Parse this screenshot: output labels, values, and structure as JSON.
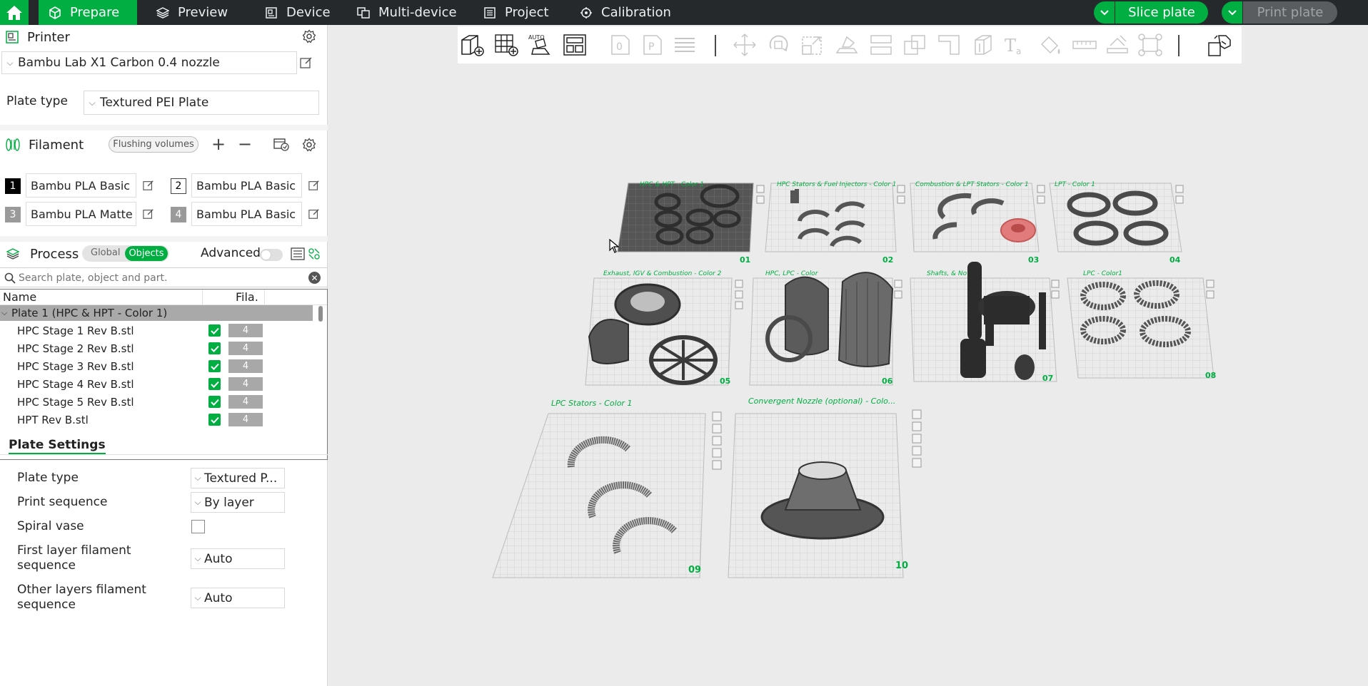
{
  "nav": {
    "tabs": [
      {
        "label": "Prepare",
        "icon": "cube-icon"
      },
      {
        "label": "Preview",
        "icon": "layers-icon"
      },
      {
        "label": "Device",
        "icon": "device-icon"
      },
      {
        "label": "Multi-device",
        "icon": "multi-device-icon"
      },
      {
        "label": "Project",
        "icon": "project-icon"
      },
      {
        "label": "Calibration",
        "icon": "calibration-icon"
      }
    ],
    "active_tab": "Prepare",
    "slice_label": "Slice plate",
    "print_label": "Print plate"
  },
  "printer": {
    "section_title": "Printer",
    "selected": "Bambu Lab X1 Carbon 0.4 nozzle",
    "plate_type_label": "Plate type",
    "plate_type_value": "Textured PEI Plate"
  },
  "filament": {
    "section_title": "Filament",
    "flushing_label": "Flushing volumes",
    "items": [
      {
        "num": "1",
        "name": "Bambu PLA Basic",
        "color": "#000000"
      },
      {
        "num": "2",
        "name": "Bambu PLA Basic",
        "color": "#ffffff"
      },
      {
        "num": "3",
        "name": "Bambu PLA Matte",
        "color": "#9a9a9a"
      },
      {
        "num": "4",
        "name": "Bambu PLA Basic",
        "color": "#9a9a9a"
      }
    ]
  },
  "process": {
    "section_title": "Process",
    "global_label": "Global",
    "objects_label": "Objects",
    "advanced_label": "Advanced",
    "search_placeholder": "Search plate, object and part."
  },
  "tree": {
    "col_name": "Name",
    "col_fila": "Fila.",
    "plate_row": "Plate 1 (HPC & HPT - Color 1)",
    "rows": [
      {
        "name": "HPC Stage 1 Rev B.stl",
        "fila": "4"
      },
      {
        "name": "HPC Stage 2 Rev B.stl",
        "fila": "4"
      },
      {
        "name": "HPC Stage 3 Rev B.stl",
        "fila": "4"
      },
      {
        "name": "HPC Stage 4 Rev B.stl",
        "fila": "4"
      },
      {
        "name": "HPC Stage 5 Rev B.stl",
        "fila": "4"
      },
      {
        "name": "HPT Rev B.stl",
        "fila": "4"
      }
    ]
  },
  "plate_settings": {
    "tab_label": "Plate Settings",
    "plate_type_label": "Plate type",
    "plate_type_value": "Textured P...",
    "print_sequence_label": "Print sequence",
    "print_sequence_value": "By layer",
    "spiral_vase_label": "Spiral vase",
    "first_layer_label_1": "First layer filament",
    "first_layer_label_2": "sequence",
    "first_layer_value": "Auto",
    "other_layers_label_1": "Other layers filament",
    "other_layers_label_2": "sequence",
    "other_layers_value": "Auto"
  },
  "plates": [
    {
      "title": "HPC & HPT - Color 1",
      "num": "01"
    },
    {
      "title": "HPC Stators & Fuel Injectors - Color 1",
      "num": "02"
    },
    {
      "title": "Combustion & LPT Stators - Color 1",
      "num": "03"
    },
    {
      "title": "LPT - Color 1",
      "num": "04"
    },
    {
      "title": "Exhaust, IGV & Combustion - Color 2",
      "num": "05"
    },
    {
      "title": "HPC, LPC - Color",
      "num": "06"
    },
    {
      "title": "Shafts, & No",
      "num": "07"
    },
    {
      "title": "LPC - Color1",
      "num": "08"
    },
    {
      "title": "LPC Stators - Color 1",
      "num": "09"
    },
    {
      "title": "Convergent Nozzle (optional) - Colo...",
      "num": "10"
    }
  ],
  "colors": {
    "accent": "#00ae42",
    "topbar": "#26292b",
    "canvas": "#ebebeb"
  }
}
